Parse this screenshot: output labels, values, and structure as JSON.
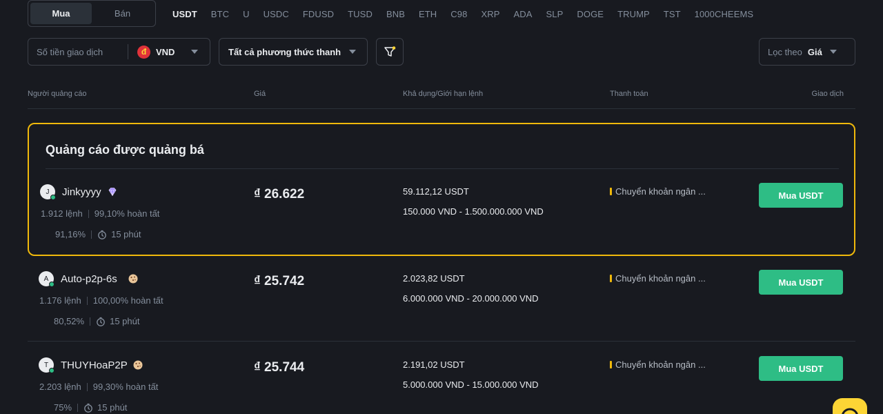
{
  "trade_toggle": {
    "buy": "Mua",
    "sell": "Bán"
  },
  "coins": [
    "USDT",
    "BTC",
    "U",
    "USDC",
    "FDUSD",
    "TUSD",
    "BNB",
    "ETH",
    "C98",
    "XRP",
    "ADA",
    "SLP",
    "DOGE",
    "TRUMP",
    "TST",
    "1000CHEEMS"
  ],
  "filters": {
    "amount_placeholder": "Số tiền giao dịch",
    "currency_symbol": "đ",
    "currency": "VND",
    "payment_method": "Tất cả phương thức thanh",
    "sort_label": "Lọc theo",
    "sort_value": "Giá"
  },
  "columns": {
    "advertiser": "Người quảng cáo",
    "price": "Giá",
    "available": "Khả dụng/Giới hạn lệnh",
    "payment": "Thanh toán",
    "trade": "Giao dịch"
  },
  "promoted_title": "Quảng cáo được quảng bá",
  "ads": [
    {
      "initial": "J",
      "name": "Jinkyyyy",
      "badge": "diamond-icon",
      "orders": "1.912 lệnh",
      "completion": "99,10% hoàn tất",
      "rating": "91,16%",
      "time": "15 phút",
      "price": "₫ 26.622",
      "available": "59.112,12 USDT",
      "limit": "150.000 VND - 1.500.000.000 VND",
      "payment": "Chuyển khoản ngân ...",
      "action": "Mua USDT"
    },
    {
      "initial": "A",
      "name": "Auto-p2p-6s",
      "badge": "cookie-icon",
      "orders": "1.176 lệnh",
      "completion": "100,00% hoàn tất",
      "rating": "80,52%",
      "time": "15 phút",
      "price": "₫ 25.742",
      "available": "2.023,82 USDT",
      "limit": "6.000.000 VND - 20.000.000 VND",
      "payment": "Chuyển khoản ngân ...",
      "action": "Mua USDT"
    },
    {
      "initial": "T",
      "name": "THUYHoaP2P",
      "badge": "cookie-icon",
      "orders": "2.203 lệnh",
      "completion": "99,30% hoàn tất",
      "rating": "75%",
      "time": "15 phút",
      "price": "₫ 25.744",
      "available": "2.191,02 USDT",
      "limit": "5.000.000 VND - 15.000.000 VND",
      "payment": "Chuyển khoản ngân ...",
      "action": "Mua USDT"
    }
  ],
  "colors": {
    "accent": "#f0b90b",
    "buy": "#2ebd85",
    "background": "#181a20"
  }
}
